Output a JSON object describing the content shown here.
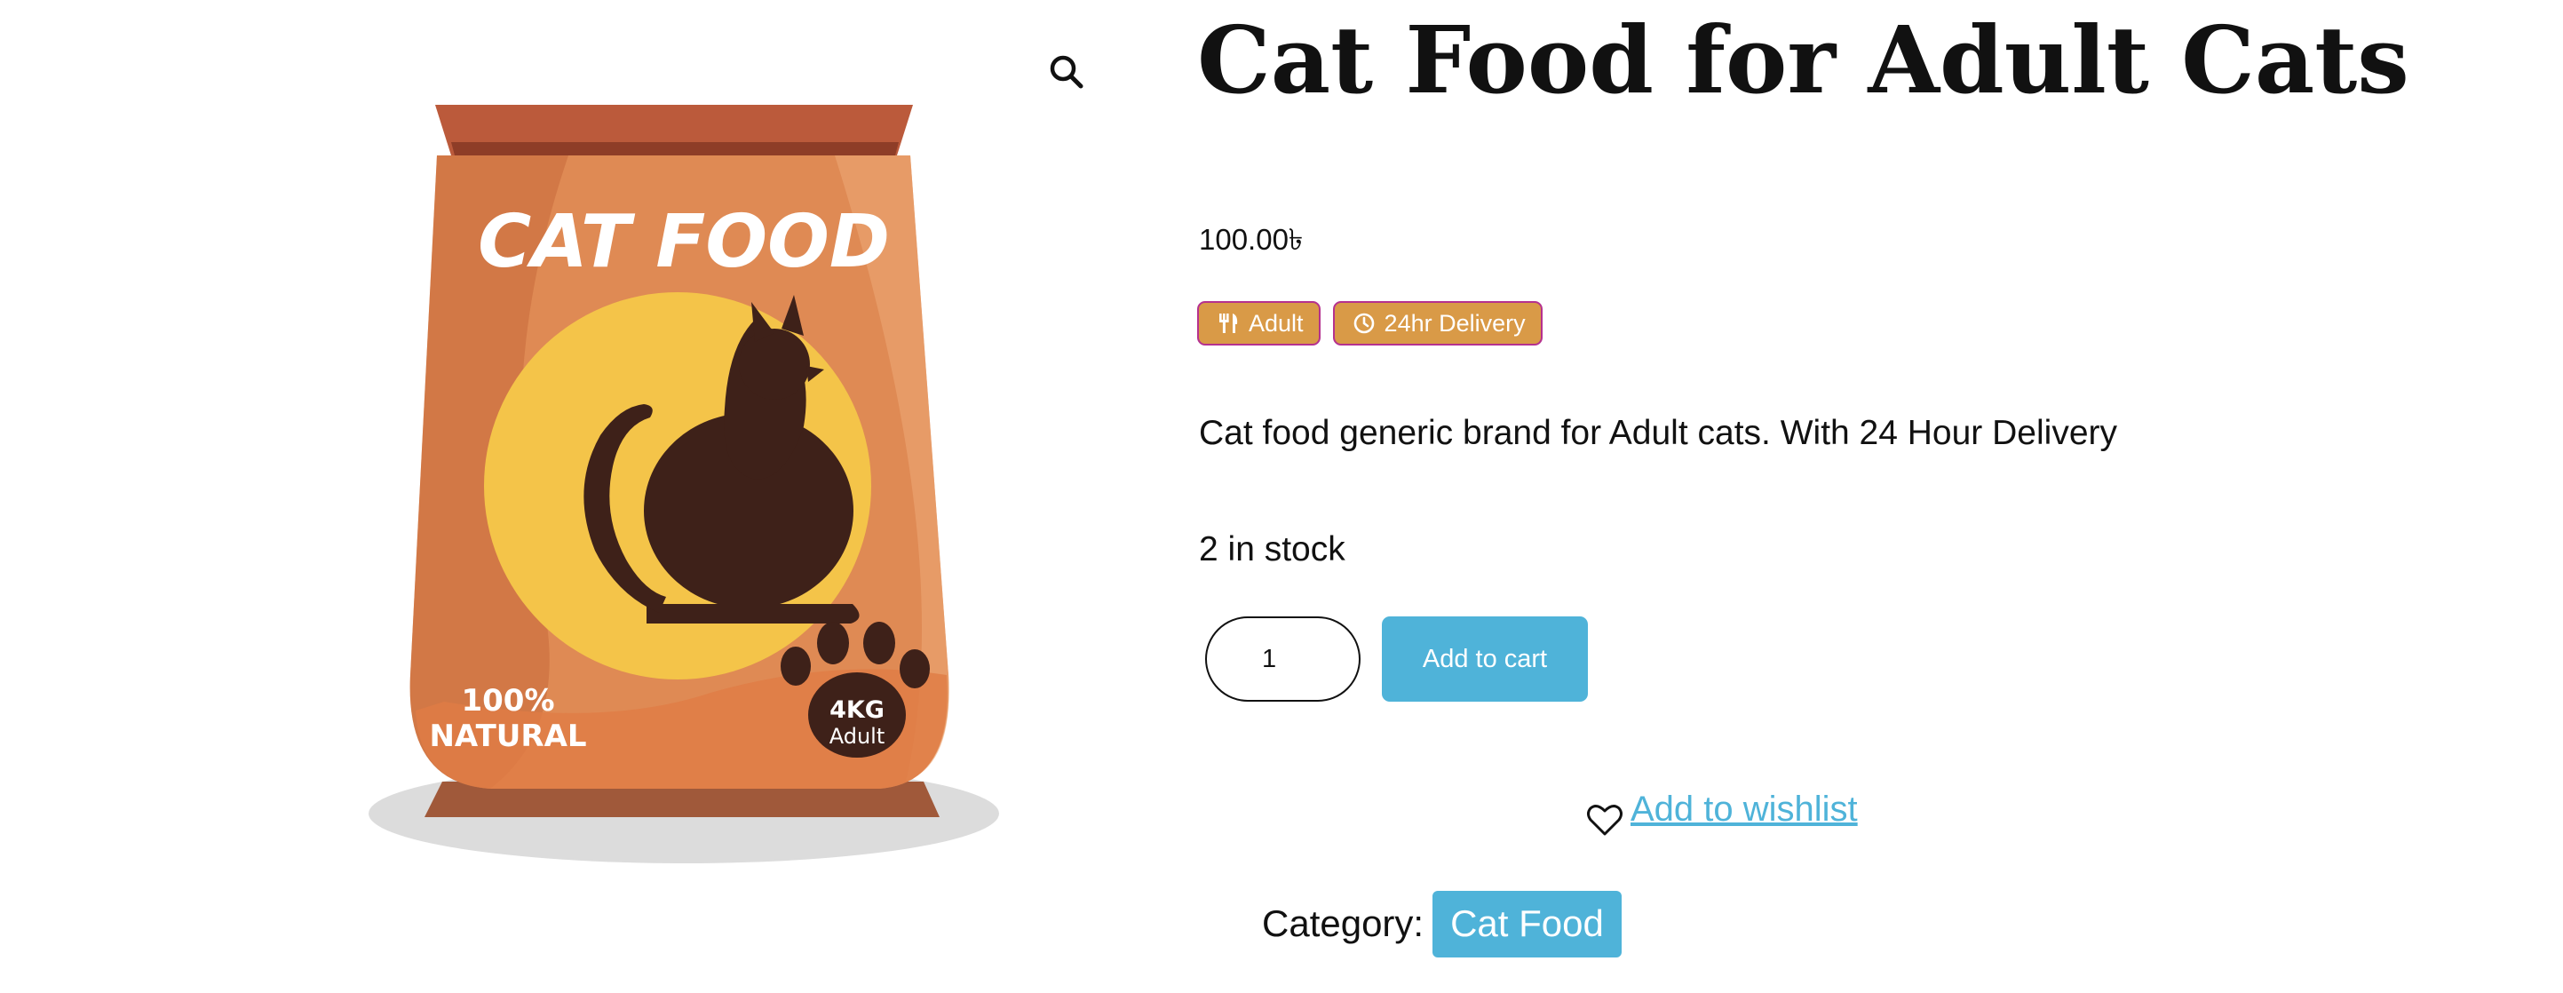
{
  "product": {
    "title": "Cat Food for Adult Cats",
    "price": "100.00৳",
    "badges": [
      {
        "icon": "utensils-icon",
        "label": "Adult"
      },
      {
        "icon": "clock-icon",
        "label": "24hr Delivery"
      }
    ],
    "description": "Cat food generic brand for Adult cats. With 24 Hour Delivery",
    "stock": "2 in stock",
    "quantity": "1",
    "add_to_cart_label": "Add to cart",
    "wishlist_label": " Add to wishlist",
    "category_label": "Category:",
    "category_value": "Cat Food"
  },
  "image": {
    "bag_brand": "CAT FOOD",
    "natural_line1": "100%",
    "natural_line2": "NATURAL",
    "weight": "4KG",
    "age": "Adult"
  },
  "colors": {
    "accent": "#4fb3d9",
    "badge_bg": "#d99a47",
    "badge_border": "#b5318f",
    "bag_orange": "#df8a54",
    "bag_top": "#bb5a3b",
    "circle_yellow": "#f4c449",
    "cat_dark": "#3e2119"
  }
}
